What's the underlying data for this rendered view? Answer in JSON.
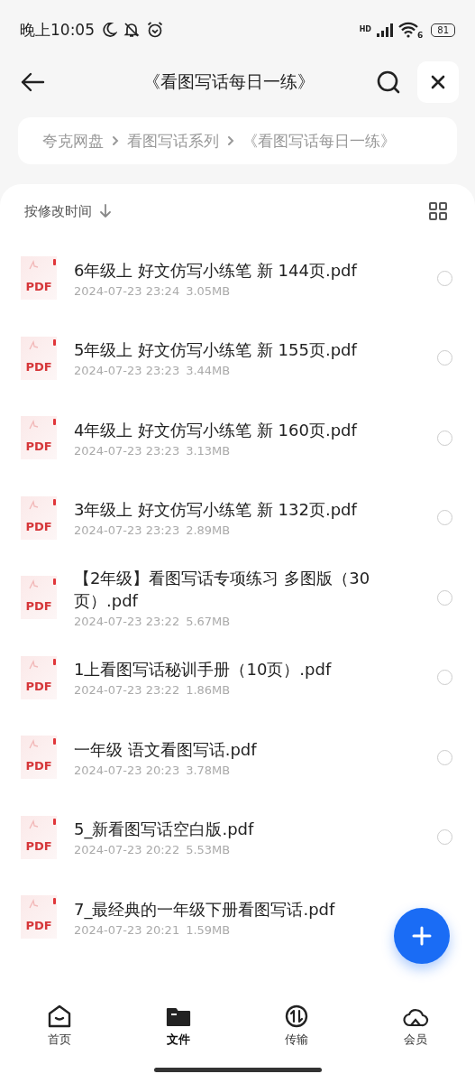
{
  "status_bar": {
    "time": "晚上10:05",
    "network_label": "HD",
    "wifi_label": "6",
    "battery": "81"
  },
  "header": {
    "title": "《看图写话每日一练》"
  },
  "breadcrumb": [
    "夸克网盘",
    "看图写话系列",
    "《看图写话每日一练》"
  ],
  "sort": {
    "label": "按修改时间"
  },
  "files": [
    {
      "name": "6年级上 好文仿写小练笔 新 144页.pdf",
      "type_label": "PDF",
      "date": "2024-07-23 23:24",
      "size": "3.05MB",
      "selected": false
    },
    {
      "name": "5年级上 好文仿写小练笔 新 155页.pdf",
      "type_label": "PDF",
      "date": "2024-07-23 23:23",
      "size": "3.44MB",
      "selected": false
    },
    {
      "name": "4年级上 好文仿写小练笔 新 160页.pdf",
      "type_label": "PDF",
      "date": "2024-07-23 23:23",
      "size": "3.13MB",
      "selected": false
    },
    {
      "name": "3年级上 好文仿写小练笔 新 132页.pdf",
      "type_label": "PDF",
      "date": "2024-07-23 23:23",
      "size": "2.89MB",
      "selected": false
    },
    {
      "name": "【2年级】看图写话专项练习 多图版（30页）.pdf",
      "type_label": "PDF",
      "date": "2024-07-23 23:22",
      "size": "5.67MB",
      "selected": false
    },
    {
      "name": "1上看图写话秘训手册（10页）.pdf",
      "type_label": "PDF",
      "date": "2024-07-23 23:22",
      "size": "1.86MB",
      "selected": false
    },
    {
      "name": "一年级 语文看图写话.pdf",
      "type_label": "PDF",
      "date": "2024-07-23 20:23",
      "size": "3.78MB",
      "selected": false
    },
    {
      "name": "5_新看图写话空白版.pdf",
      "type_label": "PDF",
      "date": "2024-07-23 20:22",
      "size": "5.53MB",
      "selected": false
    },
    {
      "name": "7_最经典的一年级下册看图写话.pdf",
      "type_label": "PDF",
      "date": "2024-07-23 20:21",
      "size": "1.59MB"
    }
  ],
  "nav": [
    {
      "label": "首页",
      "kind": "home",
      "selected": false
    },
    {
      "label": "文件",
      "kind": "folder",
      "selected": true
    },
    {
      "label": "传输",
      "kind": "transfer",
      "selected": false
    },
    {
      "label": "会员",
      "kind": "cloud",
      "selected": false
    }
  ]
}
